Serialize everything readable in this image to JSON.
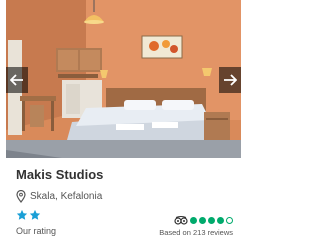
{
  "hotel": {
    "name": "Makis Studios",
    "location": "Skala, Kefalonia",
    "star_rating": 2,
    "rating_label": "Our rating"
  },
  "reviews": {
    "bubble_score": 4,
    "bubble_max": 5,
    "based_on_text": "Based on 213 reviews"
  },
  "colors": {
    "star": "#1a9fd6",
    "bubble": "#00aa6c",
    "wall": "#d98a5a"
  },
  "icons": {
    "prev": "arrow-left-icon",
    "next": "arrow-right-icon",
    "location": "map-pin-icon",
    "tripadvisor": "tripadvisor-owl-icon"
  }
}
